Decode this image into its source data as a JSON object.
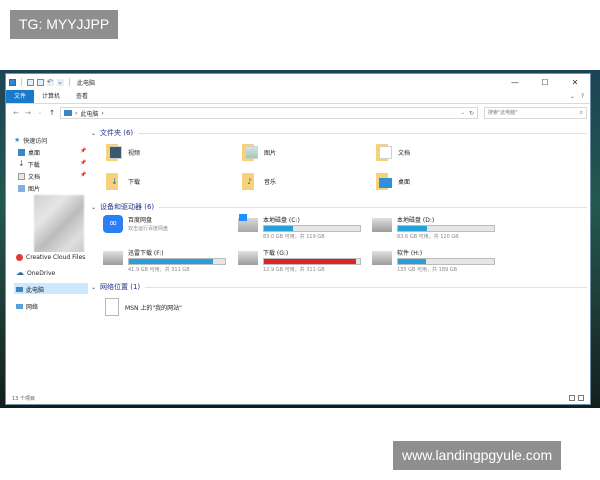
{
  "watermarks": {
    "top": "TG: MYYJJPP",
    "bottom": "www.landingpgyule.com"
  },
  "window": {
    "title": "此电脑",
    "controls": {
      "minimize": "—",
      "maximize": "☐",
      "close": "✕"
    }
  },
  "ribbon": {
    "tabs": [
      "文件",
      "计算机",
      "查看"
    ],
    "expand": "⌄",
    "help": "?"
  },
  "address": {
    "back": "←",
    "forward": "→",
    "recent": "⌄",
    "up": "↑",
    "path_arrow": "›",
    "location": "此电脑",
    "search_placeholder": "搜索\"此电脑\""
  },
  "nav_pane": {
    "quick_access": "快速访问",
    "pinned": [
      {
        "label": "桌面",
        "icon": "desktop-icon"
      },
      {
        "label": "下载",
        "icon": "download-icon"
      },
      {
        "label": "文档",
        "icon": "documents-icon"
      },
      {
        "label": "图片",
        "icon": "pictures-icon"
      }
    ],
    "creative_cloud": "Creative Cloud Files",
    "onedrive": "OneDrive",
    "this_pc": "此电脑",
    "network": "网络"
  },
  "groups": {
    "folders": "文件夹 (6)",
    "devices": "设备和驱动器 (6)",
    "network": "网络位置 (1)"
  },
  "folders": [
    {
      "label": "视频",
      "icon": "videos-icon"
    },
    {
      "label": "图片",
      "icon": "pictures-icon"
    },
    {
      "label": "文档",
      "icon": "documents-icon"
    },
    {
      "label": "下载",
      "icon": "downloads-icon"
    },
    {
      "label": "音乐",
      "icon": "music-icon"
    },
    {
      "label": "桌面",
      "icon": "desktop-icon"
    }
  ],
  "baidu": {
    "name": "百度网盘",
    "sub": "双击运行百度网盘"
  },
  "drives": [
    {
      "name": "本地磁盘 (C:)",
      "sub": "83.0 GB 可用，共 119 GB",
      "used_fraction": 0.3,
      "full": false
    },
    {
      "name": "本地磁盘 (D:)",
      "sub": "83.6 GB 可用，共 120 GB",
      "used_fraction": 0.3,
      "full": false
    },
    {
      "name": "迅雷下载 (F:)",
      "sub": "41.9 GB 可用，共 311 GB",
      "used_fraction": 0.87,
      "full": false
    },
    {
      "name": "下载 (G:)",
      "sub": "12.9 GB 可用，共 311 GB",
      "used_fraction": 0.96,
      "full": true
    },
    {
      "name": "软件 (H:)",
      "sub": "135 GB 可用，共 189 GB",
      "used_fraction": 0.29,
      "full": false
    }
  ],
  "network_item": "MSN 上的\"我的网站\"",
  "status": {
    "count": "13 个项目"
  },
  "colors": {
    "accent": "#1979ca",
    "drive_bar": "#26a0da",
    "drive_full": "#da2626",
    "group_title": "#1e3287"
  }
}
